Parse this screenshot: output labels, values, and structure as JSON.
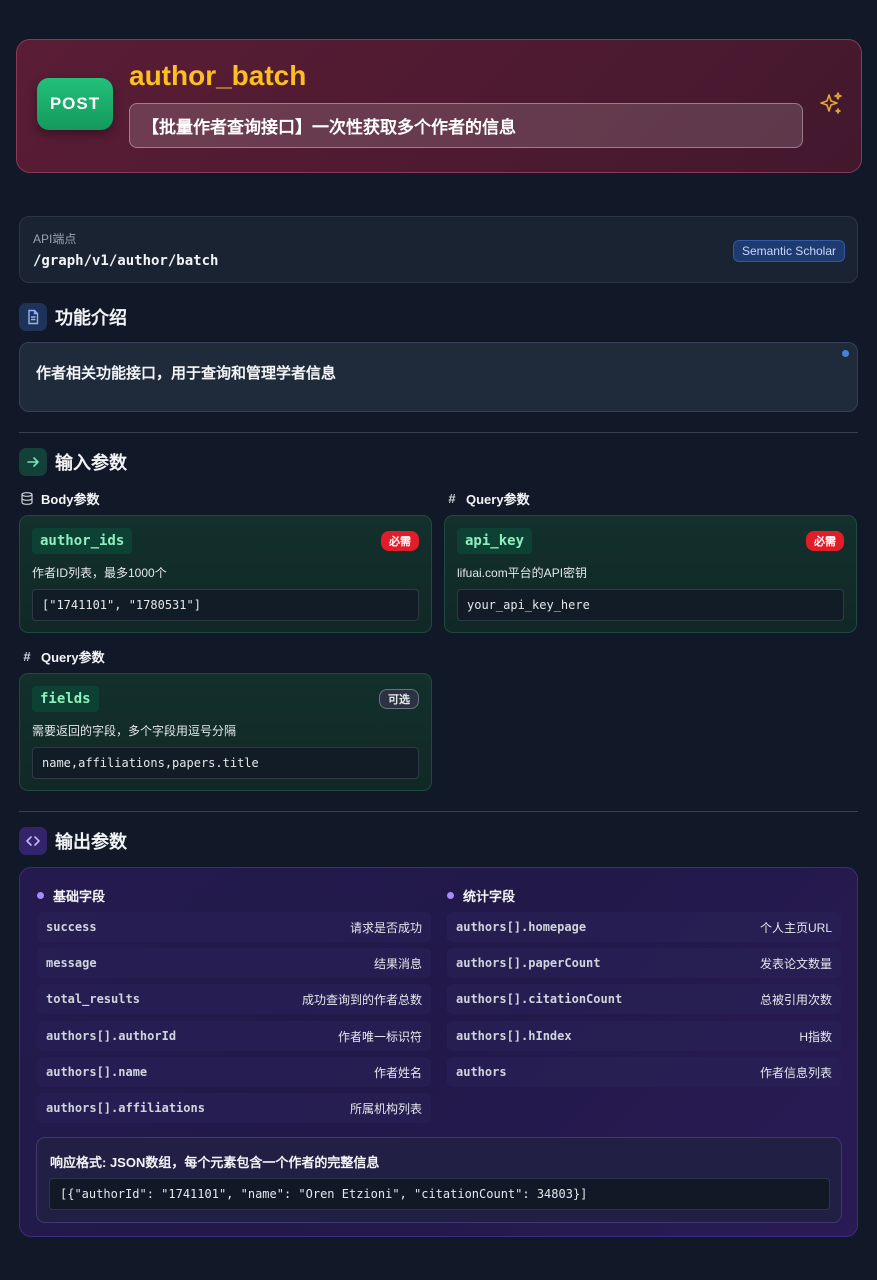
{
  "header": {
    "method": "POST",
    "name": "author_batch",
    "description": "【批量作者查询接口】一次性获取多个作者的信息",
    "sparkle_icon": "sparkles-icon",
    "colors": {
      "method": "#1aae6b",
      "name": "#fbbf24",
      "header_bg": "#5a1d35"
    }
  },
  "api": {
    "label": "API端点",
    "path": "/graph/v1/author/batch",
    "tag": "Semantic Scholar"
  },
  "intro": {
    "title": "功能介绍",
    "text": "作者相关功能接口，用于查询和管理学者信息"
  },
  "input": {
    "title": "输入参数",
    "body_group": {
      "label": "Body参数",
      "params": [
        {
          "name": "author_ids",
          "badge": "必需",
          "desc": "作者ID列表，最多1000个",
          "value": "[\"1741101\", \"1780531\"]"
        }
      ]
    },
    "query_group_right": {
      "label": "Query参数",
      "params": [
        {
          "name": "api_key",
          "badge": "必需",
          "desc": "lifuai.com平台的API密钥",
          "value": "your_api_key_here"
        }
      ]
    },
    "query_group_left": {
      "label": "Query参数",
      "params": [
        {
          "name": "fields",
          "badge": "可选",
          "desc": "需要返回的字段，多个字段用逗号分隔",
          "value": "name,affiliations,papers.title"
        }
      ]
    }
  },
  "output": {
    "title": "输出参数",
    "basic": {
      "label": "基础字段",
      "fields": [
        {
          "key": "success",
          "desc": "请求是否成功"
        },
        {
          "key": "message",
          "desc": "结果消息"
        },
        {
          "key": "total_results",
          "desc": "成功查询到的作者总数"
        },
        {
          "key": "authors[].authorId",
          "desc": "作者唯一标识符"
        },
        {
          "key": "authors[].name",
          "desc": "作者姓名"
        },
        {
          "key": "authors[].affiliations",
          "desc": "所属机构列表"
        }
      ]
    },
    "stats": {
      "label": "统计字段",
      "fields": [
        {
          "key": "authors[].homepage",
          "desc": "个人主页URL"
        },
        {
          "key": "authors[].paperCount",
          "desc": "发表论文数量"
        },
        {
          "key": "authors[].citationCount",
          "desc": "总被引用次数"
        },
        {
          "key": "authors[].hIndex",
          "desc": "H指数"
        },
        {
          "key": "authors",
          "desc": "作者信息列表"
        }
      ]
    },
    "response": {
      "title": "响应格式: JSON数组，每个元素包含一个作者的完整信息",
      "example": "[{\"authorId\": \"1741101\", \"name\": \"Oren Etzioni\", \"citationCount\": 34803}]"
    }
  }
}
